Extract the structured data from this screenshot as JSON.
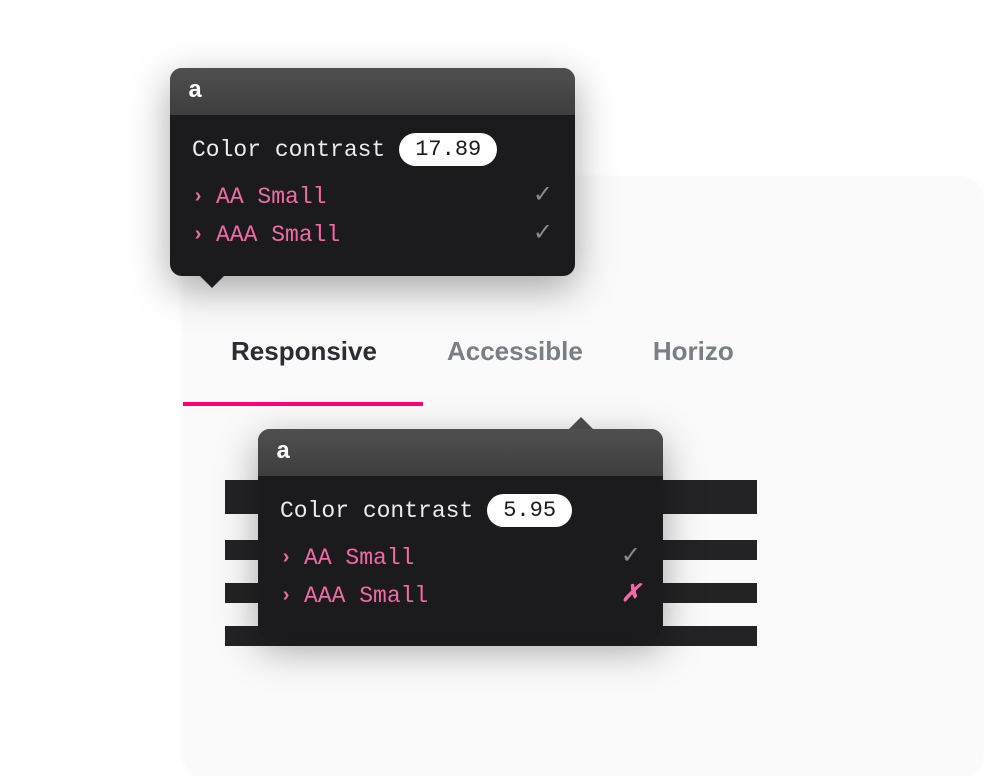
{
  "tabs": {
    "items": [
      {
        "label": "Responsive",
        "active": true
      },
      {
        "label": "Accessible",
        "active": false
      },
      {
        "label": "Horizo",
        "active": false
      }
    ]
  },
  "tooltip1": {
    "header_glyph": "a",
    "title": "Color contrast",
    "value": "17.89",
    "criteria": [
      {
        "name": "AA Small",
        "status": "pass"
      },
      {
        "name": "AAA Small",
        "status": "pass"
      }
    ]
  },
  "tooltip2": {
    "header_glyph": "a",
    "title": "Color contrast",
    "value": "5.95",
    "criteria": [
      {
        "name": "AA Small",
        "status": "pass"
      },
      {
        "name": "AAA Small",
        "status": "fail"
      }
    ]
  },
  "icons": {
    "pass": "✓",
    "fail": "✗",
    "chevron": "›"
  },
  "colors": {
    "accent": "#ff007a",
    "criteria_text": "#f06ba6",
    "tooltip_bg": "#1b1b1d",
    "tab_active": "#2a2d33",
    "tab_inactive": "#7a7e85"
  }
}
